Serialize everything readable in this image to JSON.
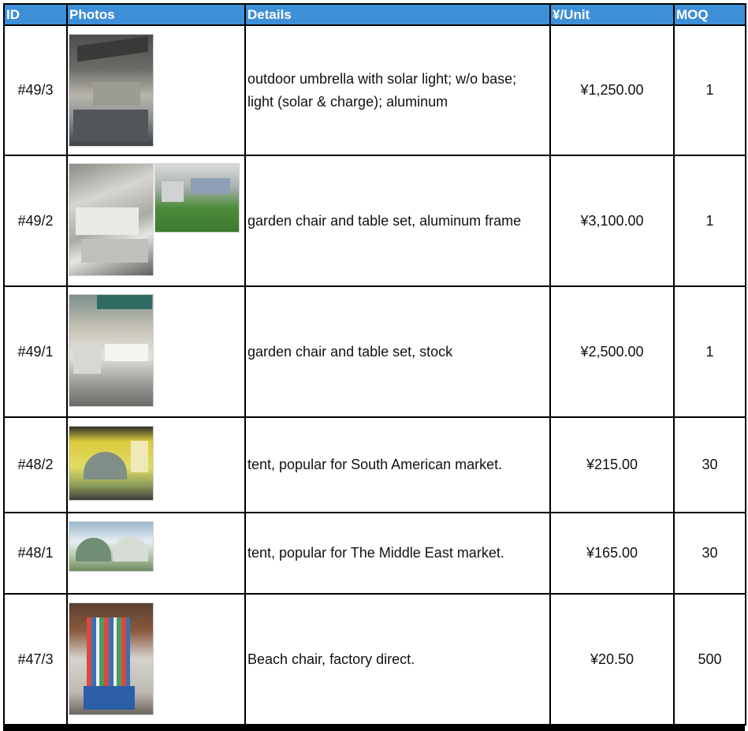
{
  "header": {
    "id": "ID",
    "photos": "Photos",
    "details": "Details",
    "price": "¥/Unit",
    "moq": "MOQ"
  },
  "colors": {
    "header_bg": "#3d8fd8",
    "header_text": "#ffffff",
    "grid": "#000000"
  },
  "rows": [
    {
      "id": "#49/3",
      "details": "outdoor umbrella with solar light; w/o base; light (solar & charge); aluminum",
      "price": "¥1,250.00",
      "moq": "1",
      "photos": [
        "outdoor-umbrella-photo"
      ]
    },
    {
      "id": "#49/2",
      "details": "garden chair and table set, aluminum frame",
      "price": "¥3,100.00",
      "moq": "1",
      "photos": [
        "garden-sofa-set-photo",
        "garden-sofa-lawn-photo"
      ]
    },
    {
      "id": "#49/1",
      "details": "garden chair and table set, stock",
      "price": "¥2,500.00",
      "moq": "1",
      "photos": [
        "garden-dining-set-photo"
      ]
    },
    {
      "id": "#48/2",
      "details": "tent, popular for South American market.",
      "price": "¥215.00",
      "moq": "30",
      "photos": [
        "tent-box-photo"
      ]
    },
    {
      "id": "#48/1",
      "details": "tent, popular for The Middle East market.",
      "price": "¥165.00",
      "moq": "30",
      "photos": [
        "tent-pair-photo"
      ]
    },
    {
      "id": "#47/3",
      "details": "Beach chair, factory direct.",
      "price": "¥20.50",
      "moq": "500",
      "photos": [
        "beach-chair-photo"
      ]
    }
  ]
}
